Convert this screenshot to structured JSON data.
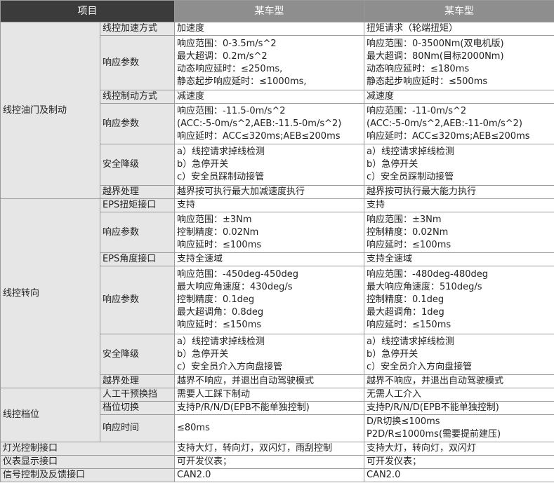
{
  "headers": {
    "item": "项目",
    "model_a": "某车型",
    "model_b": "某车型"
  },
  "sections": [
    {
      "name": "线控油门及制动",
      "rows": [
        {
          "sub": "线控加速方式",
          "a": [
            "加速度"
          ],
          "b": [
            "扭矩请求（轮端扭矩）"
          ]
        },
        {
          "sub": "响应参数",
          "a": [
            "响应范围：0-3.5m/s^2",
            "最大超调：0.2m/s^2",
            "动态响应延时：≤250ms,",
            "静态起步响应延时：≤1000ms,"
          ],
          "b": [
            "响应范围：0-3500Nm(双电机版)",
            "最大超调：80Nm(目标2000Nm)",
            "动态响应延时：≤180ms",
            "静态起步响应延时：≤500ms"
          ]
        },
        {
          "sub": "线控制动方式",
          "a": [
            "减速度"
          ],
          "b": [
            "减速度"
          ]
        },
        {
          "sub": "响应参数",
          "a": [
            "响应范围：-11.5-0m/s^2",
            "(ACC:-5-0m/s^2,AEB:-11.5-0m/s^2)",
            "响应延时：ACC≤320ms;AEB≤200ms"
          ],
          "b": [
            "响应范围：-11-0m/s^2",
            "(ACC:-5-0m/s^2,AEB:-11-0m/s^2)",
            "响应延时：ACC≤320ms;AEB≤200ms"
          ]
        },
        {
          "sub": "安全降级",
          "a": [
            "a）线控请求掉线检测",
            "b）急停开关",
            "c）安全员踩制动接管"
          ],
          "b": [
            "a）线控请求掉线检测",
            "b）急停开关",
            "c）安全员踩制动接管"
          ]
        },
        {
          "sub": "越界处理",
          "a": [
            "越界按可执行最大加减速度执行"
          ],
          "b": [
            "越界按可执行最大能力执行"
          ]
        }
      ]
    },
    {
      "name": "线控转向",
      "rows": [
        {
          "sub": "EPS扭矩接口",
          "a": [
            "支持"
          ],
          "b": [
            "支持"
          ]
        },
        {
          "sub": "响应参数",
          "a": [
            "响应范围：±3Nm",
            "控制精度：0.02Nm",
            "响应延时：≤100ms"
          ],
          "b": [
            "响应范围：±3Nm",
            "控制精度：0.02Nm",
            "响应延时：≤100ms"
          ]
        },
        {
          "sub": "EPS角度接口",
          "a": [
            "支持全速域"
          ],
          "b": [
            "支持全速域"
          ]
        },
        {
          "sub": "响应参数",
          "a": [
            "响应范围：-450deg-450deg",
            "最大响应角速度：430deg/s",
            "控制精度：0.1deg",
            "最大超调角：0.8deg",
            "响应延时：≤150ms"
          ],
          "b": [
            "响应范围：-480deg-480deg",
            "最大响应角速度：510deg/s",
            "控制精度：0.1deg",
            "最大超调角：1deg",
            "响应延时：≤150ms"
          ]
        },
        {
          "sub": "安全降级",
          "a": [
            "a）线控请求掉线检测",
            "b）急停开关",
            "c）安全员介入方向盘接管"
          ],
          "b": [
            "a）线控请求掉线检测",
            "b）急停开关",
            "c）安全员介入方向盘接管"
          ]
        },
        {
          "sub": "越界处理",
          "a": [
            "越界不响应，并退出自动驾驶模式"
          ],
          "b": [
            "越界不响应，并退出自动驾驶模式"
          ]
        }
      ]
    },
    {
      "name": "线控档位",
      "rows": [
        {
          "sub": "人工干预换挡",
          "a": [
            "需要人工踩下制动"
          ],
          "b": [
            "无需人工介入"
          ]
        },
        {
          "sub": "档位切换",
          "a": [
            "支持P/R/N/D(EPB不能单独控制)"
          ],
          "b": [
            "支持P/R/N/D(EPB不能单独控制)"
          ]
        },
        {
          "sub": "响应时间",
          "a": [
            "≤80ms"
          ],
          "b": [
            "D/R切换≤100ms",
            "P2D/R≤1000ms(需要提前建压)"
          ]
        }
      ]
    }
  ],
  "singles": [
    {
      "name": "灯光控制接口",
      "a": "支持大灯，转向灯，双闪灯，雨刮控制",
      "b": "支持大灯，转向灯，双闪灯"
    },
    {
      "name": "仪表显示接口",
      "a": "可开发仪表；",
      "b": "可开发仪表；"
    },
    {
      "name": "信号控制及反馈接口",
      "a": "CAN2.0",
      "b": "CAN2.0"
    }
  ]
}
